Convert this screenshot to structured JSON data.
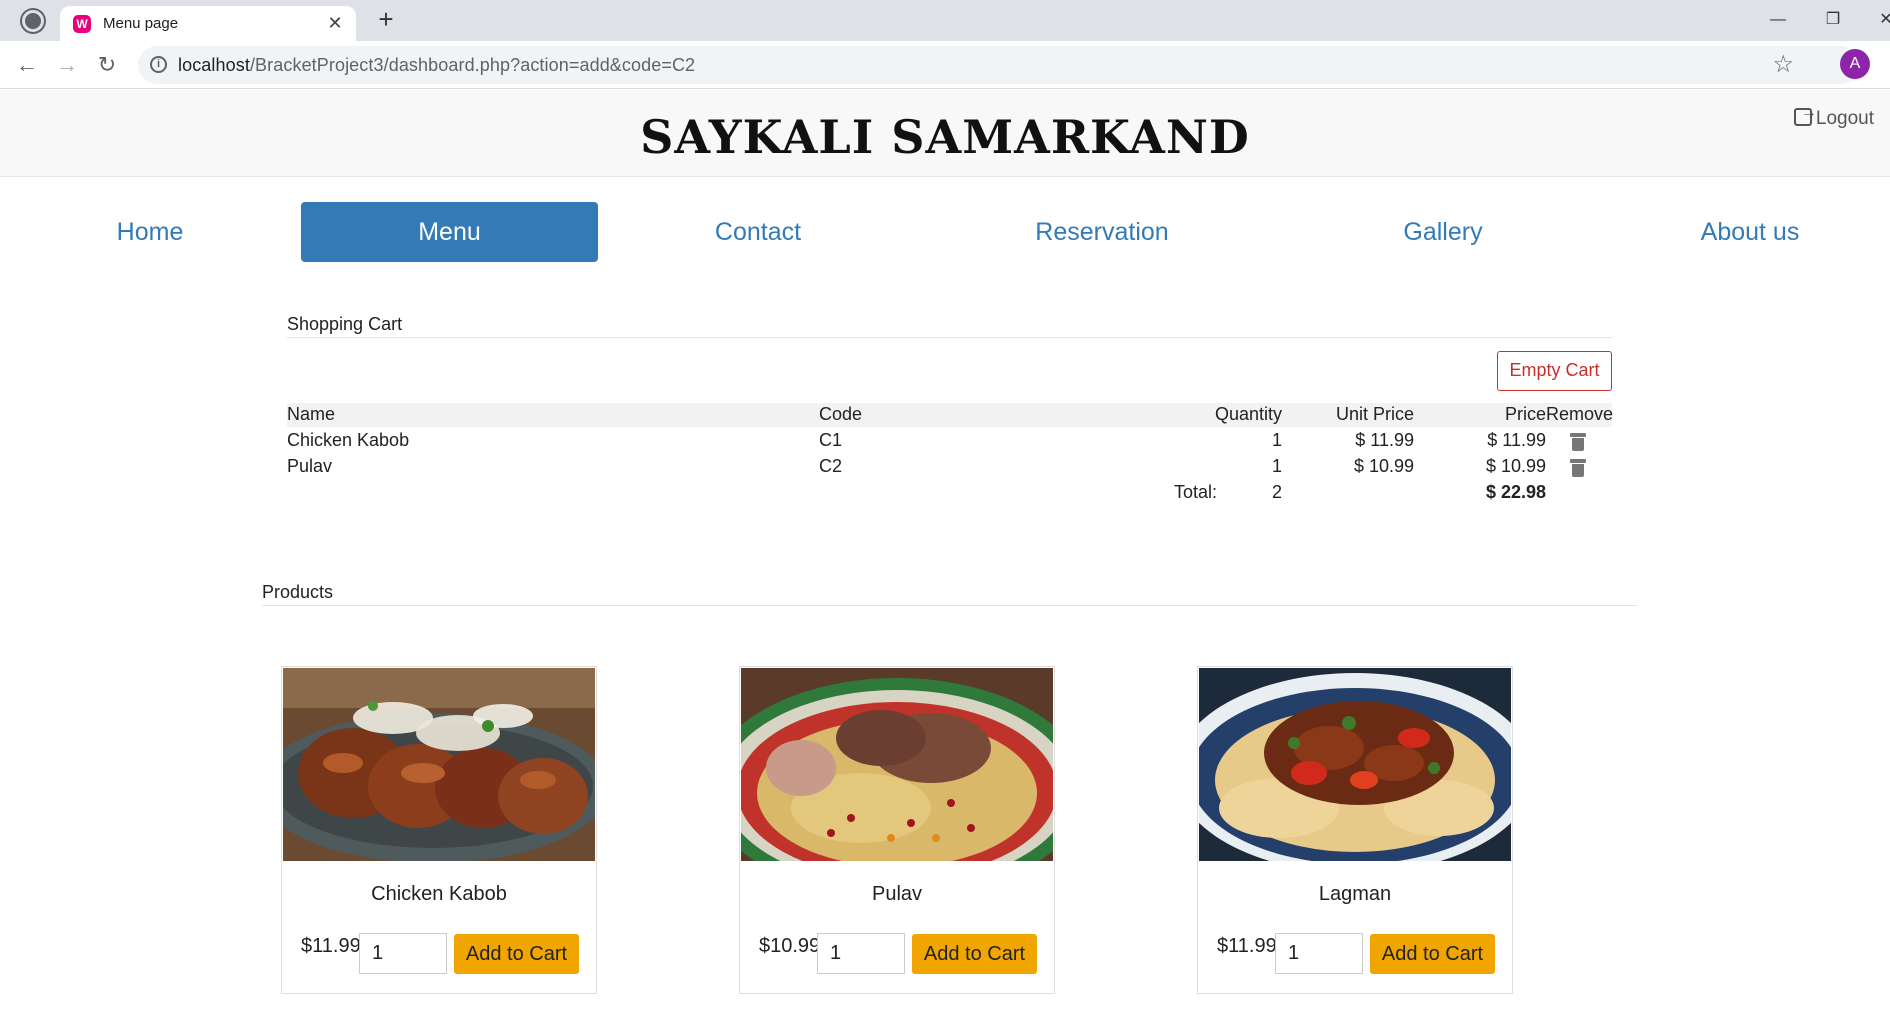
{
  "browser": {
    "tab_title": "Menu page",
    "favicon_letter": "W",
    "url_host": "localhost",
    "url_path": "/BracketProject3/dashboard.php?action=add&code=C2",
    "profile_initial": "A"
  },
  "site": {
    "title": "SAYKALI SAMARKAND",
    "logout_label": "Logout"
  },
  "nav": [
    {
      "label": "Home",
      "active": false
    },
    {
      "label": "Menu",
      "active": true
    },
    {
      "label": "Contact",
      "active": false
    },
    {
      "label": "Reservation",
      "active": false
    },
    {
      "label": "Gallery",
      "active": false
    },
    {
      "label": "About us",
      "active": false
    }
  ],
  "cart": {
    "title": "Shopping Cart",
    "empty_label": "Empty Cart",
    "columns": [
      "Name",
      "Code",
      "Quantity",
      "Unit Price",
      "Price",
      "Remove"
    ],
    "rows": [
      {
        "name": "Chicken Kabob",
        "code": "C1",
        "quantity": "1",
        "unit_price": "$ 11.99",
        "price": "$ 11.99"
      },
      {
        "name": "Pulav",
        "code": "C2",
        "quantity": "1",
        "unit_price": "$ 10.99",
        "price": "$ 10.99"
      }
    ],
    "total_label": "Total:",
    "total_quantity": "2",
    "total_price": "$ 22.98"
  },
  "products": {
    "title": "Products",
    "items": [
      {
        "name": "Chicken Kabob",
        "price": "$11.99",
        "qty": "1",
        "button": "Add to Cart"
      },
      {
        "name": "Pulav",
        "price": "$10.99",
        "qty": "1",
        "button": "Add to Cart"
      },
      {
        "name": "Lagman",
        "price": "$11.99",
        "qty": "1",
        "button": "Add to Cart"
      }
    ]
  },
  "colors": {
    "nav_blue": "#337ab7",
    "danger": "#c9302c",
    "add_button": "#f0a500"
  }
}
